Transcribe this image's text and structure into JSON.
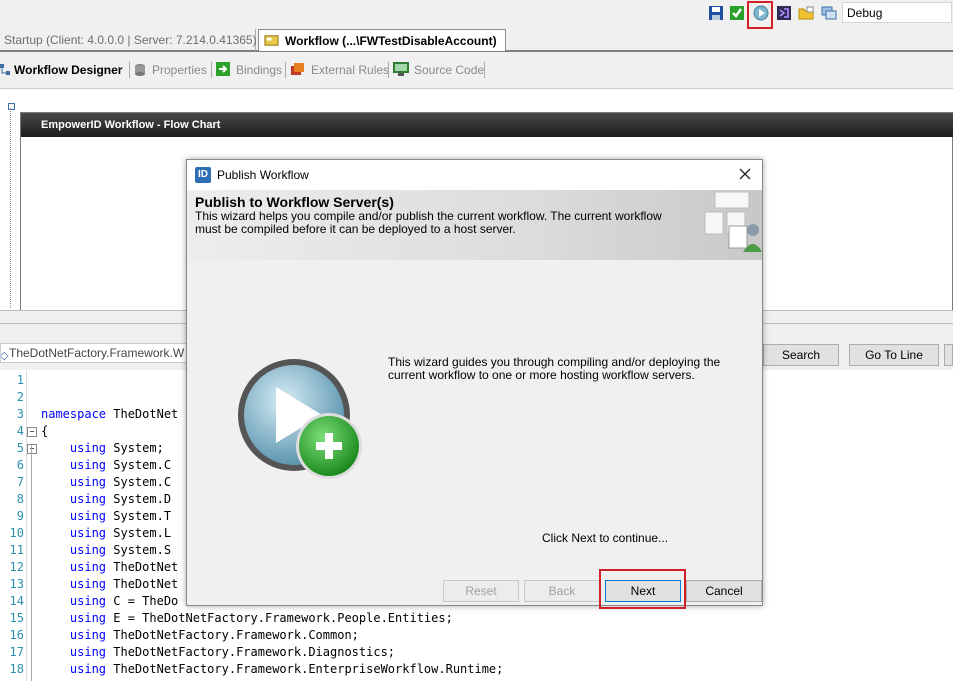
{
  "toolbar": {
    "icons": [
      "save-icon",
      "validate-icon",
      "publish-icon",
      "visual-studio-icon",
      "folder-icon",
      "compile-icon"
    ],
    "config_value": "Debug"
  },
  "doc_tabs": [
    {
      "label": "Startup (Client: 4.0.0.0 | Server: 7.214.0.41365)"
    },
    {
      "label": "Workflow (...\\FWTestDisableAccount)"
    }
  ],
  "designer_tabs": [
    {
      "label": "Workflow Designer"
    },
    {
      "label": "Properties"
    },
    {
      "label": "Bindings"
    },
    {
      "label": "External Rules"
    },
    {
      "label": "Source Code"
    }
  ],
  "flowchart": {
    "title": "EmpowerID Workflow - Flow Chart"
  },
  "code_editor": {
    "file": "TheDotNetFactory.Framework.W",
    "search_label": "Search",
    "goto_label": "Go To Line",
    "lines": [
      {
        "n": "1",
        "kw": "",
        "rest": ""
      },
      {
        "n": "2",
        "kw": "",
        "rest": ""
      },
      {
        "n": "3",
        "kw": "namespace",
        "rest": " TheDotNet"
      },
      {
        "n": "4",
        "kw": "",
        "rest": "{"
      },
      {
        "n": "5",
        "kw": "    using",
        "rest": " System;"
      },
      {
        "n": "6",
        "kw": "    using",
        "rest": " System.C"
      },
      {
        "n": "7",
        "kw": "    using",
        "rest": " System.C"
      },
      {
        "n": "8",
        "kw": "    using",
        "rest": " System.D"
      },
      {
        "n": "9",
        "kw": "    using",
        "rest": " System.T"
      },
      {
        "n": "10",
        "kw": "    using",
        "rest": " System.L"
      },
      {
        "n": "11",
        "kw": "    using",
        "rest": " System.S"
      },
      {
        "n": "12",
        "kw": "    using",
        "rest": " TheDotNet"
      },
      {
        "n": "13",
        "kw": "    using",
        "rest": " TheDotNet"
      },
      {
        "n": "14",
        "kw": "    using",
        "rest": " C = TheDo"
      },
      {
        "n": "15",
        "kw": "    using",
        "rest": " E = TheDotNetFactory.Framework.People.Entities;"
      },
      {
        "n": "16",
        "kw": "    using",
        "rest": " TheDotNetFactory.Framework.Common;"
      },
      {
        "n": "17",
        "kw": "    using",
        "rest": " TheDotNetFactory.Framework.Diagnostics;"
      },
      {
        "n": "18",
        "kw": "    using",
        "rest": " TheDotNetFactory.Framework.EnterpriseWorkflow.Runtime;"
      }
    ]
  },
  "dialog": {
    "title": "Publish Workflow",
    "header_title": "Publish to Workflow Server(s)",
    "header_desc": "This wizard helps you compile and/or publish the current workflow. The current workflow must be compiled before it can be deployed to a host server.",
    "body_text": "This wizard guides you through compiling and/or deploying the current workflow to one or more hosting workflow servers.",
    "continue_text": "Click Next to continue...",
    "buttons": {
      "reset": "Reset",
      "back": "Back",
      "next": "Next",
      "cancel": "Cancel"
    }
  },
  "colors": {
    "highlight": "#d0202a",
    "keyword": "#0000ff",
    "line_number": "#2b91af"
  }
}
